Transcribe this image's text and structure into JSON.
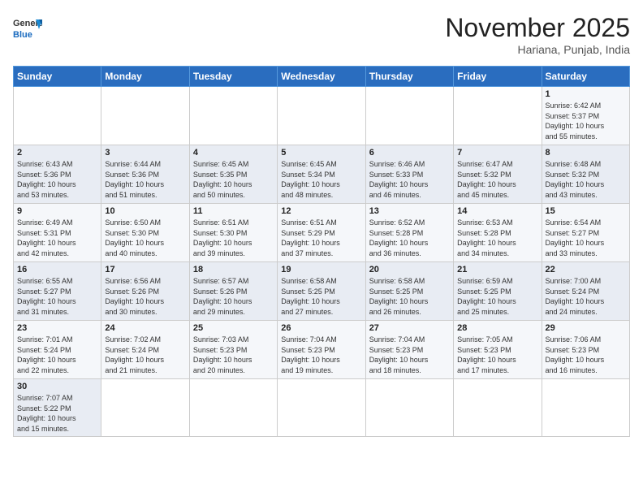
{
  "header": {
    "logo_general": "General",
    "logo_blue": "Blue",
    "title": "November 2025",
    "location": "Hariana, Punjab, India"
  },
  "days_of_week": [
    "Sunday",
    "Monday",
    "Tuesday",
    "Wednesday",
    "Thursday",
    "Friday",
    "Saturday"
  ],
  "weeks": [
    [
      {
        "day": "",
        "info": ""
      },
      {
        "day": "",
        "info": ""
      },
      {
        "day": "",
        "info": ""
      },
      {
        "day": "",
        "info": ""
      },
      {
        "day": "",
        "info": ""
      },
      {
        "day": "",
        "info": ""
      },
      {
        "day": "1",
        "info": "Sunrise: 6:42 AM\nSunset: 5:37 PM\nDaylight: 10 hours\nand 55 minutes."
      }
    ],
    [
      {
        "day": "2",
        "info": "Sunrise: 6:43 AM\nSunset: 5:36 PM\nDaylight: 10 hours\nand 53 minutes."
      },
      {
        "day": "3",
        "info": "Sunrise: 6:44 AM\nSunset: 5:36 PM\nDaylight: 10 hours\nand 51 minutes."
      },
      {
        "day": "4",
        "info": "Sunrise: 6:45 AM\nSunset: 5:35 PM\nDaylight: 10 hours\nand 50 minutes."
      },
      {
        "day": "5",
        "info": "Sunrise: 6:45 AM\nSunset: 5:34 PM\nDaylight: 10 hours\nand 48 minutes."
      },
      {
        "day": "6",
        "info": "Sunrise: 6:46 AM\nSunset: 5:33 PM\nDaylight: 10 hours\nand 46 minutes."
      },
      {
        "day": "7",
        "info": "Sunrise: 6:47 AM\nSunset: 5:32 PM\nDaylight: 10 hours\nand 45 minutes."
      },
      {
        "day": "8",
        "info": "Sunrise: 6:48 AM\nSunset: 5:32 PM\nDaylight: 10 hours\nand 43 minutes."
      }
    ],
    [
      {
        "day": "9",
        "info": "Sunrise: 6:49 AM\nSunset: 5:31 PM\nDaylight: 10 hours\nand 42 minutes."
      },
      {
        "day": "10",
        "info": "Sunrise: 6:50 AM\nSunset: 5:30 PM\nDaylight: 10 hours\nand 40 minutes."
      },
      {
        "day": "11",
        "info": "Sunrise: 6:51 AM\nSunset: 5:30 PM\nDaylight: 10 hours\nand 39 minutes."
      },
      {
        "day": "12",
        "info": "Sunrise: 6:51 AM\nSunset: 5:29 PM\nDaylight: 10 hours\nand 37 minutes."
      },
      {
        "day": "13",
        "info": "Sunrise: 6:52 AM\nSunset: 5:28 PM\nDaylight: 10 hours\nand 36 minutes."
      },
      {
        "day": "14",
        "info": "Sunrise: 6:53 AM\nSunset: 5:28 PM\nDaylight: 10 hours\nand 34 minutes."
      },
      {
        "day": "15",
        "info": "Sunrise: 6:54 AM\nSunset: 5:27 PM\nDaylight: 10 hours\nand 33 minutes."
      }
    ],
    [
      {
        "day": "16",
        "info": "Sunrise: 6:55 AM\nSunset: 5:27 PM\nDaylight: 10 hours\nand 31 minutes."
      },
      {
        "day": "17",
        "info": "Sunrise: 6:56 AM\nSunset: 5:26 PM\nDaylight: 10 hours\nand 30 minutes."
      },
      {
        "day": "18",
        "info": "Sunrise: 6:57 AM\nSunset: 5:26 PM\nDaylight: 10 hours\nand 29 minutes."
      },
      {
        "day": "19",
        "info": "Sunrise: 6:58 AM\nSunset: 5:25 PM\nDaylight: 10 hours\nand 27 minutes."
      },
      {
        "day": "20",
        "info": "Sunrise: 6:58 AM\nSunset: 5:25 PM\nDaylight: 10 hours\nand 26 minutes."
      },
      {
        "day": "21",
        "info": "Sunrise: 6:59 AM\nSunset: 5:25 PM\nDaylight: 10 hours\nand 25 minutes."
      },
      {
        "day": "22",
        "info": "Sunrise: 7:00 AM\nSunset: 5:24 PM\nDaylight: 10 hours\nand 24 minutes."
      }
    ],
    [
      {
        "day": "23",
        "info": "Sunrise: 7:01 AM\nSunset: 5:24 PM\nDaylight: 10 hours\nand 22 minutes."
      },
      {
        "day": "24",
        "info": "Sunrise: 7:02 AM\nSunset: 5:24 PM\nDaylight: 10 hours\nand 21 minutes."
      },
      {
        "day": "25",
        "info": "Sunrise: 7:03 AM\nSunset: 5:23 PM\nDaylight: 10 hours\nand 20 minutes."
      },
      {
        "day": "26",
        "info": "Sunrise: 7:04 AM\nSunset: 5:23 PM\nDaylight: 10 hours\nand 19 minutes."
      },
      {
        "day": "27",
        "info": "Sunrise: 7:04 AM\nSunset: 5:23 PM\nDaylight: 10 hours\nand 18 minutes."
      },
      {
        "day": "28",
        "info": "Sunrise: 7:05 AM\nSunset: 5:23 PM\nDaylight: 10 hours\nand 17 minutes."
      },
      {
        "day": "29",
        "info": "Sunrise: 7:06 AM\nSunset: 5:23 PM\nDaylight: 10 hours\nand 16 minutes."
      }
    ],
    [
      {
        "day": "30",
        "info": "Sunrise: 7:07 AM\nSunset: 5:22 PM\nDaylight: 10 hours\nand 15 minutes."
      },
      {
        "day": "",
        "info": ""
      },
      {
        "day": "",
        "info": ""
      },
      {
        "day": "",
        "info": ""
      },
      {
        "day": "",
        "info": ""
      },
      {
        "day": "",
        "info": ""
      },
      {
        "day": "",
        "info": ""
      }
    ]
  ]
}
